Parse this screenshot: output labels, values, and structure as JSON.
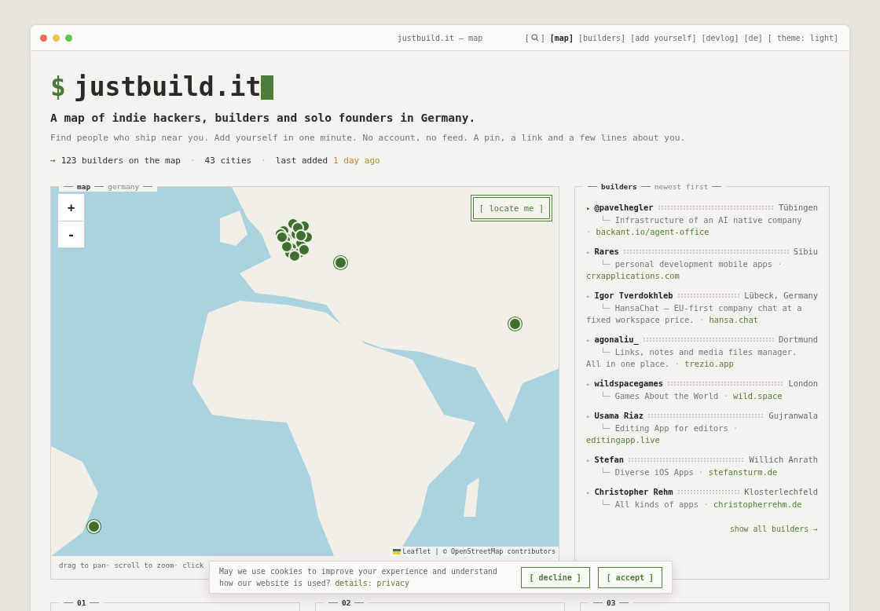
{
  "window": {
    "title": "justbuild.it — map"
  },
  "nav": [
    {
      "kind": "search",
      "before": "[",
      "after": "]",
      "selected": false
    },
    {
      "kind": "link",
      "label": "[map]",
      "selected": true
    },
    {
      "kind": "link",
      "label": "[builders]",
      "selected": false
    },
    {
      "kind": "link",
      "label": "[add yourself]",
      "selected": false
    },
    {
      "kind": "link",
      "label": "[devlog]",
      "selected": false
    },
    {
      "kind": "link",
      "label": "[de]",
      "selected": false
    },
    {
      "kind": "link",
      "label": "[ theme: light]",
      "selected": false
    }
  ],
  "hero": {
    "prompt": "$",
    "title": "justbuild.it",
    "tagline": "A map of indie hackers, builders and solo founders in Germany.",
    "intro": "Find people who ship near you. Add yourself in one minute. No account, no feed. A pin, a link and a few lines about you."
  },
  "stats": {
    "arrow": "→",
    "builders": "123 builders on the map",
    "sep1": "·",
    "cities": "43 cities",
    "sep2": "·",
    "last_label": "last added",
    "last_value": "1 day ago"
  },
  "map": {
    "legend_title": "map",
    "legend_sub": "germany",
    "zoom_in": "+",
    "zoom_out": "-",
    "locate": "[ locate me ]",
    "attribution": "Leaflet | © OpenStreetMap contributors",
    "hint": "drag to pan· scroll to zoom· click"
  },
  "builders": {
    "legend_title": "builders",
    "legend_sub": "newest first",
    "show_all": "show all builders →",
    "items": [
      {
        "marker": "▸",
        "selected": true,
        "sep": "·",
        "name": "@pavelhegler",
        "city": "Tübingen",
        "branch": "└─",
        "description": "Infrastructure of an AI native company",
        "link": "backant.io/agent-office"
      },
      {
        "marker": "▸",
        "selected": false,
        "sep": "·",
        "name": "Rares",
        "city": "Sibiu",
        "branch": "└─",
        "description": "personal development mobile apps",
        "link": "crxapplications.com"
      },
      {
        "marker": "▸",
        "selected": false,
        "sep": "·",
        "name": "Igor Tverdokhleb",
        "city": "Lübeck, Germany",
        "branch": "└─",
        "description": "HansaChat — EU-first company chat at a fixed workspace price.",
        "link": "hansa.chat"
      },
      {
        "marker": "▸",
        "selected": false,
        "sep": "·",
        "name": "agonaliu_",
        "city": "Dortmund",
        "branch": "└─",
        "description": "Links, notes and media files manager. All in one place.",
        "link": "trezio.app"
      },
      {
        "marker": "▸",
        "selected": false,
        "sep": "·",
        "name": "wildspacegames",
        "city": "London",
        "branch": "└─",
        "description": "Games About the World",
        "link": "wild.space"
      },
      {
        "marker": "▸",
        "selected": false,
        "sep": "·",
        "name": "Usama Riaz",
        "city": "Gujranwala",
        "branch": "└─",
        "description": "Editing App for editors",
        "link": "editingapp.live"
      },
      {
        "marker": "▸",
        "selected": false,
        "sep": "·",
        "name": "Stefan",
        "city": "Willich Anrath",
        "branch": "└─",
        "description": "Diverse iOS Apps",
        "link": "stefansturm.de"
      },
      {
        "marker": "▸",
        "selected": false,
        "sep": "·",
        "name": "Christopher Rehm",
        "city": "Klosterlechfeld",
        "branch": "└─",
        "description": "All kinds of apps",
        "link": "christopherrehm.de"
      }
    ]
  },
  "sections": [
    {
      "legend": "01"
    },
    {
      "legend": "02"
    },
    {
      "legend": "03"
    }
  ],
  "cookie": {
    "text": "May we use cookies to improve your experience and understand how our website is used?",
    "link": "details: privacy",
    "decline": "[ decline ]",
    "accept": "[ accept ]"
  }
}
